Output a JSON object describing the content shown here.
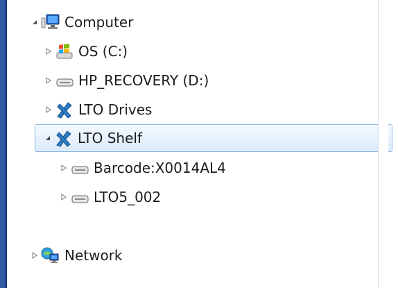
{
  "tree": {
    "items": [
      {
        "label": "Computer",
        "icon": "computer-icon",
        "expander": "expanded",
        "selected": false
      },
      {
        "label": "OS (C:)",
        "icon": "windows-drive-icon",
        "expander": "collapsed",
        "selected": false
      },
      {
        "label": "HP_RECOVERY (D:)",
        "icon": "hard-drive-icon",
        "expander": "collapsed",
        "selected": false
      },
      {
        "label": "LTO Drives",
        "icon": "lto-icon",
        "expander": "collapsed",
        "selected": false
      },
      {
        "label": "LTO Shelf",
        "icon": "lto-icon",
        "expander": "expanded",
        "selected": true
      },
      {
        "label": "Barcode:X0014AL4",
        "icon": "tape-drive-icon",
        "expander": "collapsed",
        "selected": false
      },
      {
        "label": "LTO5_002",
        "icon": "tape-drive-icon",
        "expander": "collapsed",
        "selected": false
      },
      {
        "label": "Network",
        "icon": "network-icon",
        "expander": "collapsed",
        "selected": false
      }
    ]
  },
  "colors": {
    "selection_border": "#8db4e3",
    "selection_fill": "#dbeaf9",
    "left_border": "#2d5aa3"
  }
}
